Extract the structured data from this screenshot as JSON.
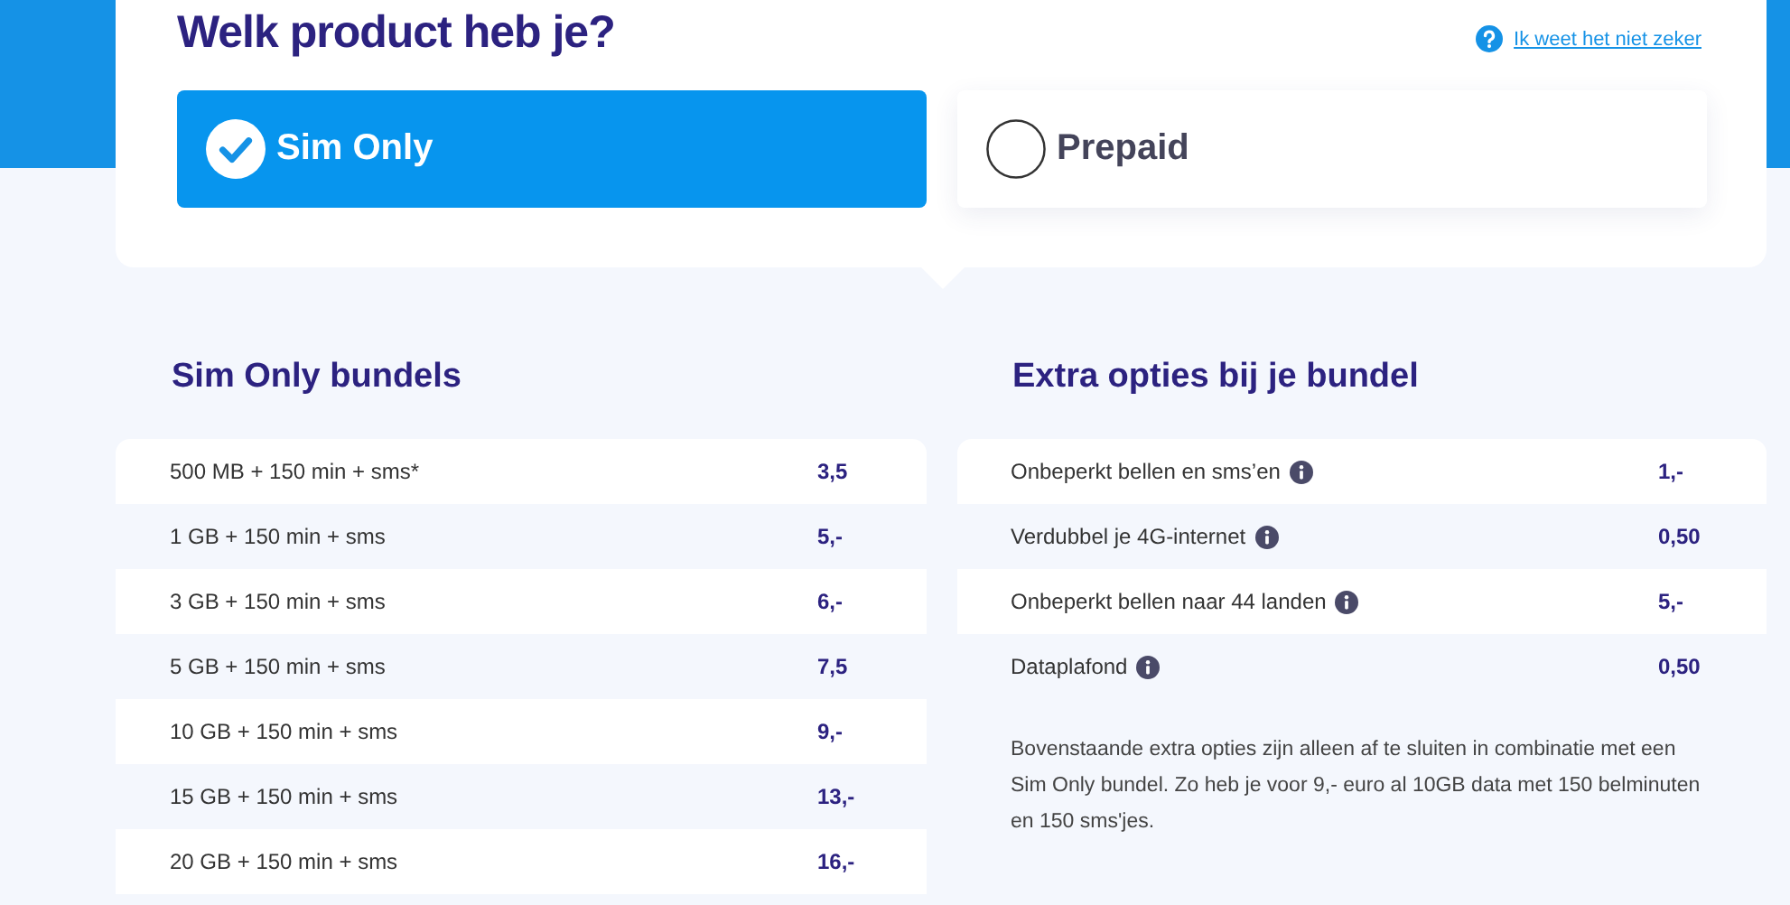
{
  "product_question": {
    "title": "Welk product heb je?",
    "help_link": "Ik weet het niet zeker",
    "options": [
      {
        "label": "Sim Only",
        "selected": true
      },
      {
        "label": "Prepaid",
        "selected": false
      }
    ]
  },
  "bundles": {
    "title": "Sim Only bundels",
    "rows": [
      {
        "name": "500 MB  + 150 min + sms*",
        "price": "3,5"
      },
      {
        "name": "1 GB  + 150 min + sms",
        "price": "5,-"
      },
      {
        "name": "3 GB  + 150 min + sms",
        "price": "6,-"
      },
      {
        "name": "5 GB  + 150 min + sms",
        "price": "7,5"
      },
      {
        "name": "10 GB  + 150 min + sms",
        "price": "9,-"
      },
      {
        "name": "15 GB  + 150 min + sms",
        "price": "13,-"
      },
      {
        "name": "20 GB  + 150 min + sms",
        "price": "16,-"
      }
    ]
  },
  "extras": {
    "title": "Extra opties bij je bundel",
    "rows": [
      {
        "name": "Onbeperkt bellen en sms’en",
        "price": "1,-"
      },
      {
        "name": "Verdubbel je 4G-internet",
        "price": "0,50"
      },
      {
        "name": "Onbeperkt bellen naar 44 landen",
        "price": "5,-"
      },
      {
        "name": "Dataplafond",
        "price": "0,50"
      }
    ],
    "note": "Bovenstaande extra opties zijn alleen af te sluiten in combinatie met een Sim Only bundel. Zo heb je voor 9,- euro al 10GB data met 150 belminuten en 150 sms'jes."
  }
}
